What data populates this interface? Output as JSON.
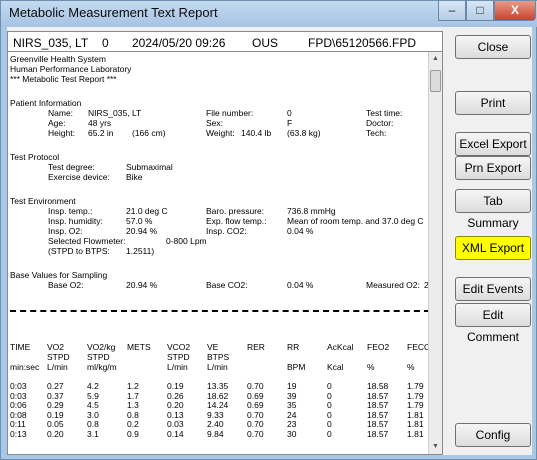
{
  "window": {
    "title": "Metabolic Measurement Text Report",
    "min_glyph": "–",
    "max_glyph": "□",
    "close_glyph": "X"
  },
  "header": {
    "subject": "NIRS_035, LT",
    "num": "0",
    "datetime": "2024/05/20 09:26",
    "system": "OUS",
    "file": "FPD\\65120566.FPD"
  },
  "report": {
    "org1": "Greenville Health System",
    "org2": "Human Performance Laboratory",
    "org3": "*** Metabolic Test Report ***",
    "patient_info": {
      "heading": "Patient Information",
      "name_label": "Name:",
      "name_value": "NIRS_035, LT",
      "age_label": "Age:",
      "age_value": "48 yrs",
      "height_label": "Height:",
      "height_value": "65.2 in",
      "height_cm": "(166 cm)",
      "file_label": "File number:",
      "file_value": "0",
      "sex_label": "Sex:",
      "sex_value": "F",
      "weight_label": "Weight:",
      "weight_value": "140.4 lb",
      "weight_kg": "(63.8 kg)",
      "test_time_label": "Test time:",
      "doctor_label": "Doctor:",
      "tech_label": "Tech:"
    },
    "protocol": {
      "heading": "Test Protocol",
      "degree_label": "Test degree:",
      "degree_value": "Submaximal",
      "device_label": "Exercise device:",
      "device_value": "Bike"
    },
    "environment": {
      "heading": "Test Environment",
      "temp_label": "Insp. temp.:",
      "temp_value": "21.0 deg C",
      "humidity_label": "Insp. humidity:",
      "humidity_value": "57.0 %",
      "o2_label": "Insp. O2:",
      "o2_value": "20.94 %",
      "flowmeter_label": "Selected Flowmeter:",
      "flowmeter_value": "0-800 Lpm",
      "btps_label": "(STPD to BTPS:",
      "btps_value": "1.2511)",
      "baro_label": "Baro. pressure:",
      "baro_value": "736.8 mmHg",
      "exp_flow_label": "Exp. flow temp.:",
      "exp_flow_value": "Mean of room temp. and 37.0 deg C",
      "co2_label": "Insp. CO2:",
      "co2_value": "0.04 %"
    },
    "baseline": {
      "heading": "Base Values for Sampling",
      "o2_label": "Base O2:",
      "o2_value": "20.94 %",
      "co2_label": "Base CO2:",
      "co2_value": "0.04 %",
      "measured_label": "Measured O2:",
      "measured_value": "2"
    },
    "table": {
      "header_row1": [
        "TIME",
        "VO2",
        "VO2/kg",
        "METS",
        "VCO2",
        "VE",
        "RER",
        "RR",
        "AcKcal",
        "FEO2",
        "FECO"
      ],
      "header_row2": [
        "",
        "STPD",
        "STPD",
        "",
        "STPD",
        "BTPS",
        "",
        "",
        "",
        "",
        ""
      ],
      "header_row3": [
        "min:sec",
        "L/min",
        "ml/kg/m",
        "",
        "L/min",
        "L/min",
        "",
        "BPM",
        "Kcal",
        "%",
        "%"
      ],
      "rows": [
        [
          "0:03",
          "0.27",
          "4.2",
          "1.2",
          "0.19",
          "13.35",
          "0.70",
          "19",
          "0",
          "18.58",
          "1.79"
        ],
        [
          "0:03",
          "0.37",
          "5.9",
          "1.7",
          "0.26",
          "18.62",
          "0.69",
          "39",
          "0",
          "18.57",
          "1.79"
        ],
        [
          "0:06",
          "0.29",
          "4.5",
          "1.3",
          "0.20",
          "14.24",
          "0.69",
          "35",
          "0",
          "18.57",
          "1.79"
        ],
        [
          "0:08",
          "0.19",
          "3.0",
          "0.8",
          "0.13",
          "9.33",
          "0.70",
          "24",
          "0",
          "18.57",
          "1.81"
        ],
        [
          "0:11",
          "0.05",
          "0.8",
          "0.2",
          "0.03",
          "2.40",
          "0.70",
          "23",
          "0",
          "18.57",
          "1.81"
        ],
        [
          "0:13",
          "0.20",
          "3.1",
          "0.9",
          "0.14",
          "9.84",
          "0.70",
          "30",
          "0",
          "18.57",
          "1.81"
        ]
      ]
    }
  },
  "buttons": {
    "close": "Close",
    "print": "Print",
    "excel_export": "Excel Export",
    "prn_export": "Prn Export",
    "tab_summary": "Tab Summary",
    "xml_export": "XML Export",
    "edit_events": "Edit Events",
    "edit_comment": "Edit Comment",
    "config": "Config"
  },
  "scrollbar": {
    "up_icon": "▲",
    "down_icon": "▼"
  },
  "colors": {
    "highlight": "#ffff00",
    "title_bar": "#a9c7e6",
    "close_button": "#c8432c"
  }
}
